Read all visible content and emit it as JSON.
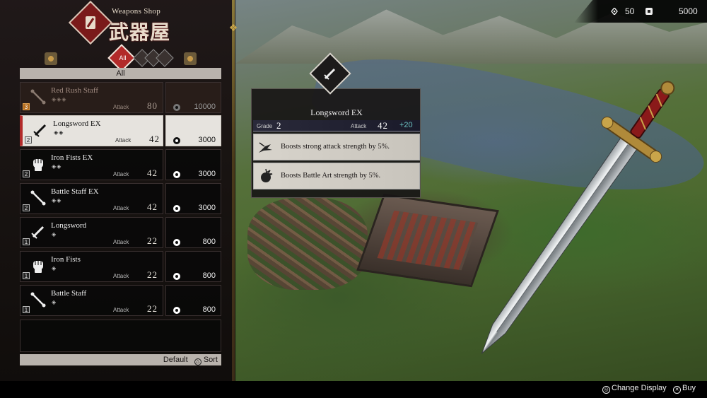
{
  "header": {
    "subtitle": "Weapons Shop",
    "kanji": "武器屋",
    "emblem_icon": "sword-scroll-icon"
  },
  "categories": {
    "active_label": "All",
    "header_label": "All",
    "icons": [
      "lb-button-icon",
      "sword-category-icon",
      "fist-category-icon",
      "staff-category-icon",
      "rb-button-icon"
    ]
  },
  "currency": {
    "primary_icon": "spirit-icon",
    "primary_value": "50",
    "secondary_icon": "coin-icon",
    "secondary_value": "5000"
  },
  "items": [
    {
      "name": "Red Rush Staff",
      "grade": "3",
      "diamonds": "◈◈◈",
      "attack_label": "Attack",
      "attack": "80",
      "price": "10000",
      "icon": "staff-icon",
      "state": "unaffordable"
    },
    {
      "name": "Longsword EX",
      "grade": "2",
      "diamonds": "◈◈",
      "attack_label": "Attack",
      "attack": "42",
      "price": "3000",
      "icon": "sword-icon",
      "state": "selected"
    },
    {
      "name": "Iron Fists EX",
      "grade": "2",
      "diamonds": "◈◈",
      "attack_label": "Attack",
      "attack": "42",
      "price": "3000",
      "icon": "fists-icon",
      "state": "normal"
    },
    {
      "name": "Battle Staff EX",
      "grade": "2",
      "diamonds": "◈◈",
      "attack_label": "Attack",
      "attack": "42",
      "price": "3000",
      "icon": "staff-icon",
      "state": "normal"
    },
    {
      "name": "Longsword",
      "grade": "1",
      "diamonds": "◈",
      "attack_label": "Attack",
      "attack": "22",
      "price": "800",
      "icon": "sword-icon",
      "state": "normal"
    },
    {
      "name": "Iron Fists",
      "grade": "1",
      "diamonds": "◈",
      "attack_label": "Attack",
      "attack": "22",
      "price": "800",
      "icon": "fists-icon",
      "state": "normal"
    },
    {
      "name": "Battle Staff",
      "grade": "1",
      "diamonds": "◈",
      "attack_label": "Attack",
      "attack": "22",
      "price": "800",
      "icon": "staff-icon",
      "state": "normal"
    }
  ],
  "list_footer": {
    "default_label": "Default",
    "sort_glyph": "△",
    "sort_label": "Sort"
  },
  "detail": {
    "icon": "sword-icon",
    "name": "Longsword EX",
    "grade_label": "Grade",
    "grade": "2",
    "attack_label": "Attack",
    "attack": "42",
    "attack_bonus": "+20",
    "effects": [
      {
        "icon": "strong-attack-icon",
        "text": "Boosts strong attack strength by 5%."
      },
      {
        "icon": "battle-art-icon",
        "text": "Boosts Battle Art strength by 5%."
      }
    ]
  },
  "bottom_hints": {
    "change_glyph": "◎",
    "change_label": "Change Display",
    "buy_glyph": "✕",
    "buy_label": "Buy"
  },
  "colors": {
    "accent_red": "#b22a2a",
    "gold": "#c9a54a",
    "bonus_teal": "#6ac0c0"
  }
}
